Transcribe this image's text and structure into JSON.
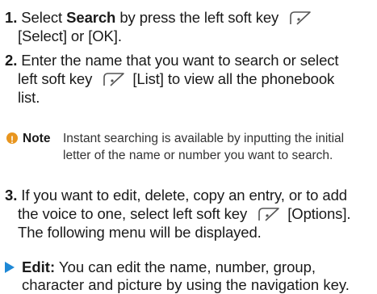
{
  "steps": [
    {
      "number": "1.",
      "bold_word": "Search",
      "line1_pre": "Select",
      "line1_post": "by press the left soft key",
      "line2": "[Select] or [OK]."
    },
    {
      "number": "2.",
      "line1": "Enter the name that you want to search or select",
      "line2_pre": "left soft key",
      "line2_post": "[List] to view all the phonebook",
      "line3": "list."
    },
    {
      "number": "3.",
      "line1": "If you want to edit, delete, copy an entry, or to add",
      "line2_pre": "the voice to one, select left soft key",
      "line2_post": "[Options].",
      "line3": "The following menu will be displayed."
    }
  ],
  "note": {
    "label": "Note",
    "line1": "Instant searching is available by inputting the initial",
    "line2": "letter of the name or number you want to search."
  },
  "bullet": {
    "label": "Edit:",
    "line1": "You can edit the name, number, group,",
    "line2": "character and picture by using the navigation key."
  },
  "icons": {
    "softkey": "left-soft-key-icon",
    "note": "note-icon",
    "bullet": "triangle-bullet-icon"
  },
  "colors": {
    "note_marker": "#e8951e",
    "bullet_marker": "#1e88d6"
  }
}
